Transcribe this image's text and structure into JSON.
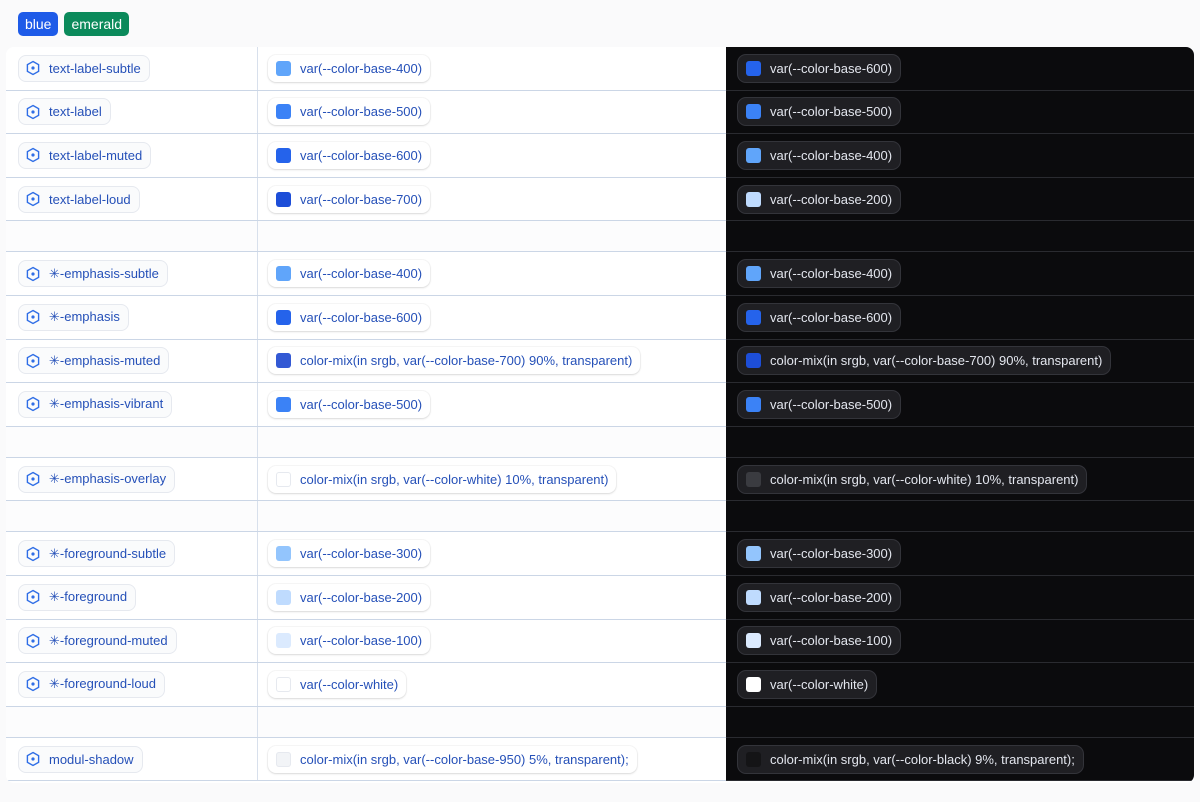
{
  "tabs": [
    {
      "label": "blue",
      "color": "#1e5be8"
    },
    {
      "label": "emerald",
      "color": "#0b8a5b"
    }
  ],
  "colors": {
    "base_100": "#dbeafe",
    "base_200": "#bfdbfe",
    "base_300": "#93c5fd",
    "base_400": "#60a5fa",
    "base_500": "#3b82f6",
    "base_600": "#2563eb",
    "base_700": "#1d4ed8",
    "white": "#ffffff",
    "dark_bg": "#0b0b0d"
  },
  "rows": [
    {
      "token": "text-label-subtle",
      "light": "var(--color-base-400)",
      "dark": "var(--color-base-600)"
    },
    {
      "token": "text-label",
      "light": "var(--color-base-500)",
      "dark": "var(--color-base-500)"
    },
    {
      "token": "text-label-muted",
      "light": "var(--color-base-600)",
      "dark": "var(--color-base-400)"
    },
    {
      "token": "text-label-loud",
      "light": "var(--color-base-700)",
      "dark": "var(--color-base-200)"
    },
    {
      "token": "✳-emphasis-subtle",
      "light": "var(--color-base-400)",
      "dark": "var(--color-base-400)"
    },
    {
      "token": "✳-emphasis",
      "light": "var(--color-base-600)",
      "dark": "var(--color-base-600)"
    },
    {
      "token": "✳-emphasis-muted",
      "light": "color-mix(in srgb, var(--color-base-700) 90%, transparent)",
      "dark": "color-mix(in srgb, var(--color-base-700) 90%, transparent)"
    },
    {
      "token": "✳-emphasis-vibrant",
      "light": "var(--color-base-500)",
      "dark": "var(--color-base-500)"
    },
    {
      "token": "✳-emphasis-overlay",
      "light": "color-mix(in srgb, var(--color-white) 10%, transparent)",
      "dark": "color-mix(in srgb, var(--color-white) 10%, transparent)"
    },
    {
      "token": "✳-foreground-subtle",
      "light": "var(--color-base-300)",
      "dark": "var(--color-base-300)"
    },
    {
      "token": "✳-foreground",
      "light": "var(--color-base-200)",
      "dark": "var(--color-base-200)"
    },
    {
      "token": "✳-foreground-muted",
      "light": "var(--color-base-100)",
      "dark": "var(--color-base-100)"
    },
    {
      "token": "✳-foreground-loud",
      "light": "var(--color-white)",
      "dark": "var(--color-white)"
    },
    {
      "token": "modul-shadow",
      "light": "color-mix(in srgb, var(--color-base-950) 5%, transparent);",
      "dark": "color-mix(in srgb, var(--color-black) 9%, transparent);"
    }
  ]
}
